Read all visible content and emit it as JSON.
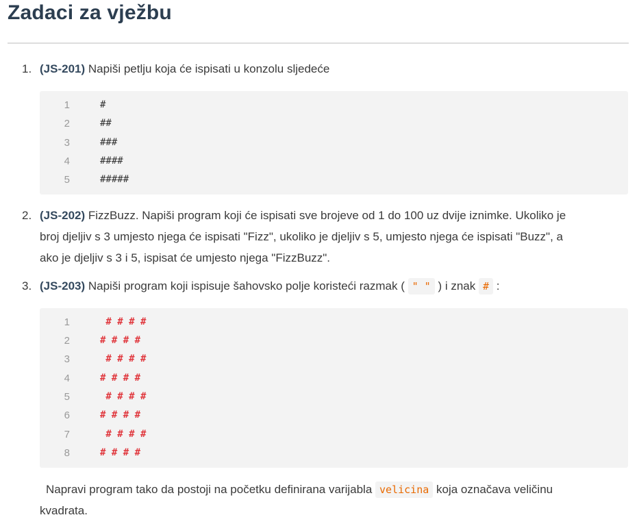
{
  "heading": "Zadaci za vježbu",
  "tasks": [
    {
      "number": "1.",
      "tag": "(JS-201)",
      "text": " Napiši petlju koja će ispisati u konzolu sljedeće",
      "code_lines": [
        "#",
        "##",
        "###",
        "####",
        "#####"
      ],
      "line_numbers": [
        "1",
        "2",
        "3",
        "4",
        "5"
      ]
    },
    {
      "number": "2.",
      "tag": "(JS-202)",
      "lines": [
        " FizzBuzz. Napiši program koji će ispisati sve brojeve od 1 do 100 uz dvije iznimke. Ukoliko je",
        "broj djeljiv s 3 umjesto njega će ispisati \"Fizz\", ukoliko je djeljiv s 5, umjesto njega će ispisati \"Buzz\", a",
        "ako je djeljiv s 3 i 5, ispisat će umjesto njega \"FizzBuzz\"."
      ]
    },
    {
      "number": "3.",
      "tag": "(JS-203)",
      "text_before": " Napiši program koji ispisuje šahovsko polje koristeći razmak (",
      "inline_space": "\" \"",
      "text_middle": ") i znak",
      "inline_hash": "#",
      "text_after": ":",
      "code_lines": [
        " # # # #",
        "# # # #",
        " # # # #",
        "# # # #",
        " # # # #",
        "# # # #",
        " # # # #",
        "# # # #"
      ],
      "line_numbers": [
        "1",
        "2",
        "3",
        "4",
        "5",
        "6",
        "7",
        "8"
      ],
      "note_before": "Napravi program tako da postoji na početku definirana varijabla",
      "note_code": "velicina",
      "note_after": "koja označava veličinu",
      "note_line2": "kvadrata."
    }
  ]
}
